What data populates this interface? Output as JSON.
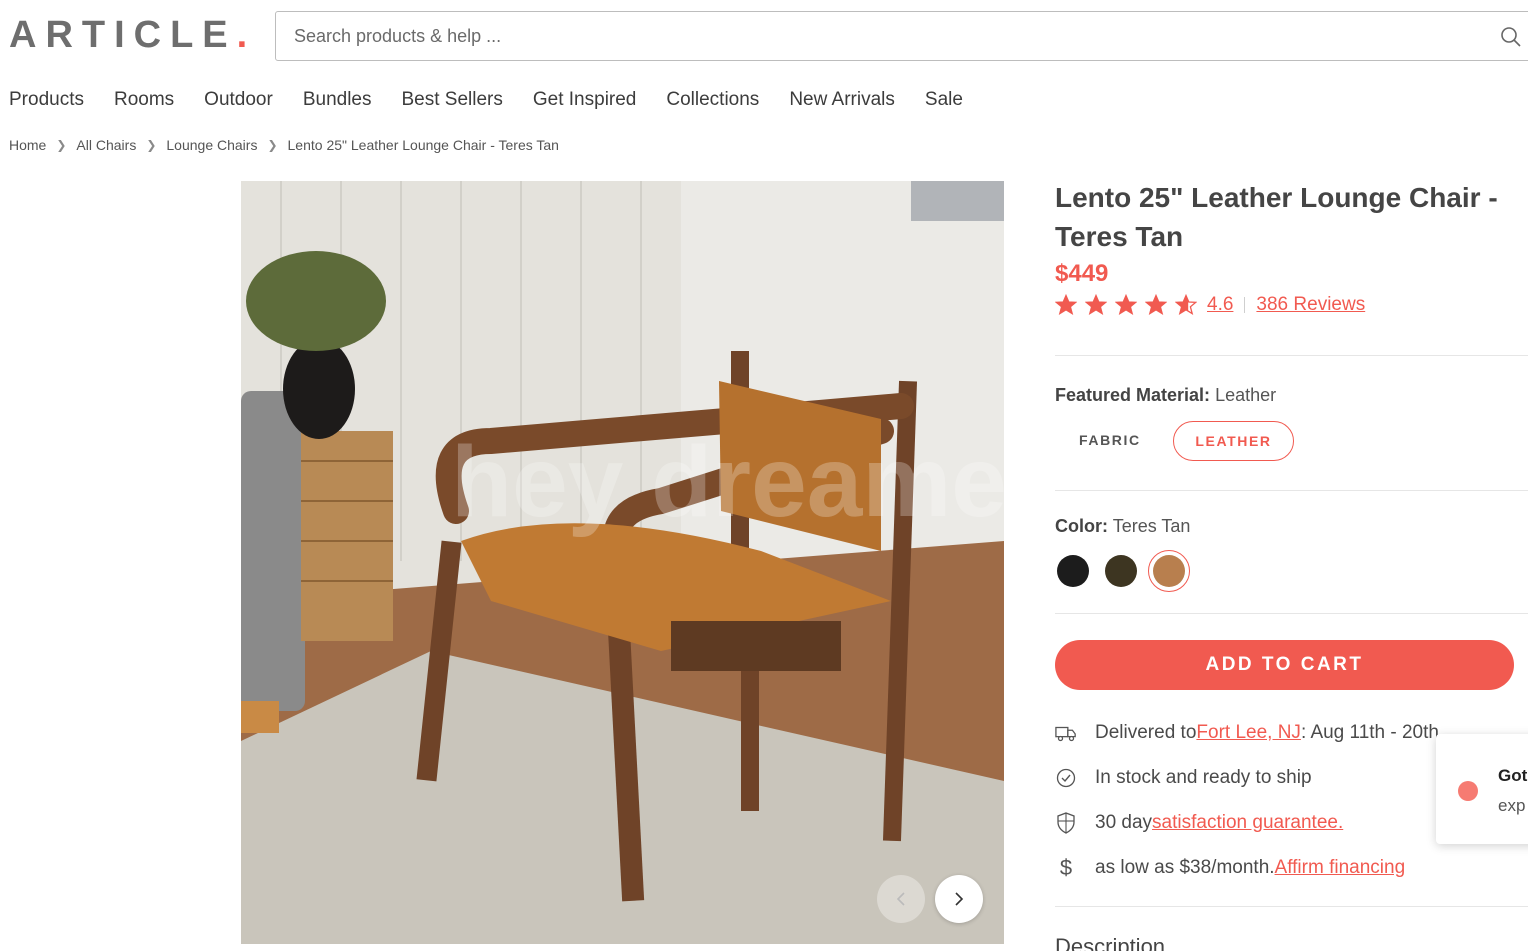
{
  "brand": {
    "logo_text": "ARTICLE",
    "logo_dot": "."
  },
  "search": {
    "placeholder": "Search products & help ..."
  },
  "nav": [
    "Products",
    "Rooms",
    "Outdoor",
    "Bundles",
    "Best Sellers",
    "Get Inspired",
    "Collections",
    "New Arrivals",
    "Sale"
  ],
  "breadcrumb": [
    "Home",
    "All Chairs",
    "Lounge Chairs",
    "Lento 25\" Leather Lounge Chair - Teres Tan"
  ],
  "product": {
    "title": "Lento 25\" Leather Lounge Chair - Teres Tan",
    "price": "$449",
    "stars": 4.6,
    "rating": "4.6",
    "reviews": "386 Reviews",
    "image_watermark": "hey dreamean®"
  },
  "material": {
    "label": "Featured Material:",
    "value": "Leather",
    "options": [
      "FABRIC",
      "LEATHER"
    ]
  },
  "color": {
    "label": "Color:",
    "value": "Teres Tan",
    "swatches": [
      "#1c1c1c",
      "#3d3521",
      "#b87f4e"
    ]
  },
  "cart": {
    "label": "ADD TO CART"
  },
  "features": {
    "delivery_prefix": "Delivered to ",
    "delivery_location": "Fort Lee, NJ",
    "delivery_suffix": " : Aug 11th - 20th",
    "stock": "In stock and ready to ship",
    "guarantee_prefix": "30 day ",
    "guarantee_link": "satisfaction guarantee.",
    "financing_prefix": "as low as $38/month. ",
    "financing_link": "Affirm financing"
  },
  "description_heading": "Description",
  "toast": {
    "title": "Got",
    "body": "exp"
  },
  "colors": {
    "accent": "#f15a50",
    "logo": "#6e6e6e"
  }
}
